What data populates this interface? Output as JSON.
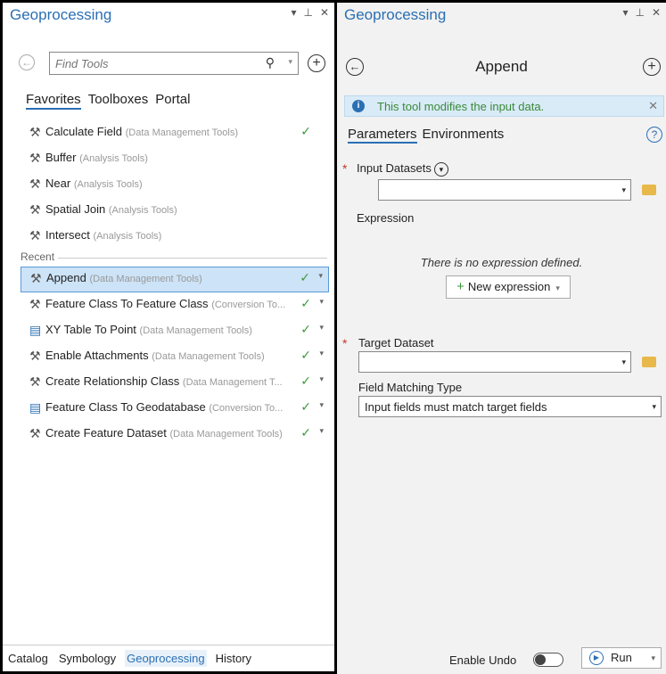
{
  "left": {
    "title": "Geoprocessing",
    "ctrl_pin": "▾",
    "ctrl_dock": "⊥",
    "ctrl_close": "✕",
    "search": {
      "placeholder": "Find Tools"
    },
    "tabs": [
      {
        "label": "Favorites",
        "active": true
      },
      {
        "label": "Toolboxes",
        "active": false
      },
      {
        "label": "Portal",
        "active": false
      }
    ],
    "recent_label": "Recent",
    "favorites": [
      {
        "name": "Calculate Field",
        "category": "(Data Management Tools)",
        "icon": "hammer-icon",
        "checked": true
      },
      {
        "name": "Buffer",
        "category": "(Analysis Tools)",
        "icon": "hammer-icon",
        "checked": false
      },
      {
        "name": "Near",
        "category": "(Analysis Tools)",
        "icon": "hammer-icon",
        "checked": false
      },
      {
        "name": "Spatial Join",
        "category": "(Analysis Tools)",
        "icon": "hammer-icon",
        "checked": false
      },
      {
        "name": "Intersect",
        "category": "(Analysis Tools)",
        "icon": "hammer-icon",
        "checked": false
      }
    ],
    "recent": [
      {
        "name": "Append",
        "category": "(Data Management Tools)",
        "icon": "hammer-icon",
        "checked": true,
        "selected": true
      },
      {
        "name": "Feature Class To Feature Class",
        "category": "(Conversion To...",
        "icon": "hammer-icon",
        "checked": true
      },
      {
        "name": "XY Table To Point",
        "category": "(Data Management Tools)",
        "icon": "script-icon",
        "checked": true
      },
      {
        "name": "Enable Attachments",
        "category": "(Data Management Tools)",
        "icon": "hammer-icon",
        "checked": true
      },
      {
        "name": "Create Relationship Class",
        "category": "(Data Management T...",
        "icon": "hammer-icon",
        "checked": true
      },
      {
        "name": "Feature Class To Geodatabase",
        "category": "(Conversion To...",
        "icon": "script-icon",
        "checked": true
      },
      {
        "name": "Create Feature Dataset",
        "category": "(Data Management Tools)",
        "icon": "hammer-icon",
        "checked": true
      }
    ],
    "bottom_tabs": [
      {
        "label": "Catalog",
        "active": false
      },
      {
        "label": "Symbology",
        "active": false
      },
      {
        "label": "Geoprocessing",
        "active": true
      },
      {
        "label": "History",
        "active": false
      }
    ]
  },
  "right": {
    "title": "Geoprocessing",
    "tool_title": "Append",
    "info_text": "This tool modifies the input data.",
    "param_tabs": [
      {
        "label": "Parameters",
        "active": true
      },
      {
        "label": "Environments",
        "active": false
      }
    ],
    "input_datasets_label": "Input Datasets",
    "input_datasets_value": "",
    "expression_label": "Expression",
    "no_expression_text": "There is no expression defined.",
    "new_expression_label": "New expression",
    "target_dataset_label": "Target Dataset",
    "target_dataset_value": "",
    "field_matching_label": "Field Matching Type",
    "field_matching_value": "Input fields must match target fields",
    "enable_undo_label": "Enable Undo",
    "enable_undo_on": false,
    "run_label": "Run"
  },
  "colors": {
    "accent": "#2b6fb3",
    "check": "#3a9a3a",
    "required": "#c0392b",
    "info_bg": "#d9ebf7"
  }
}
